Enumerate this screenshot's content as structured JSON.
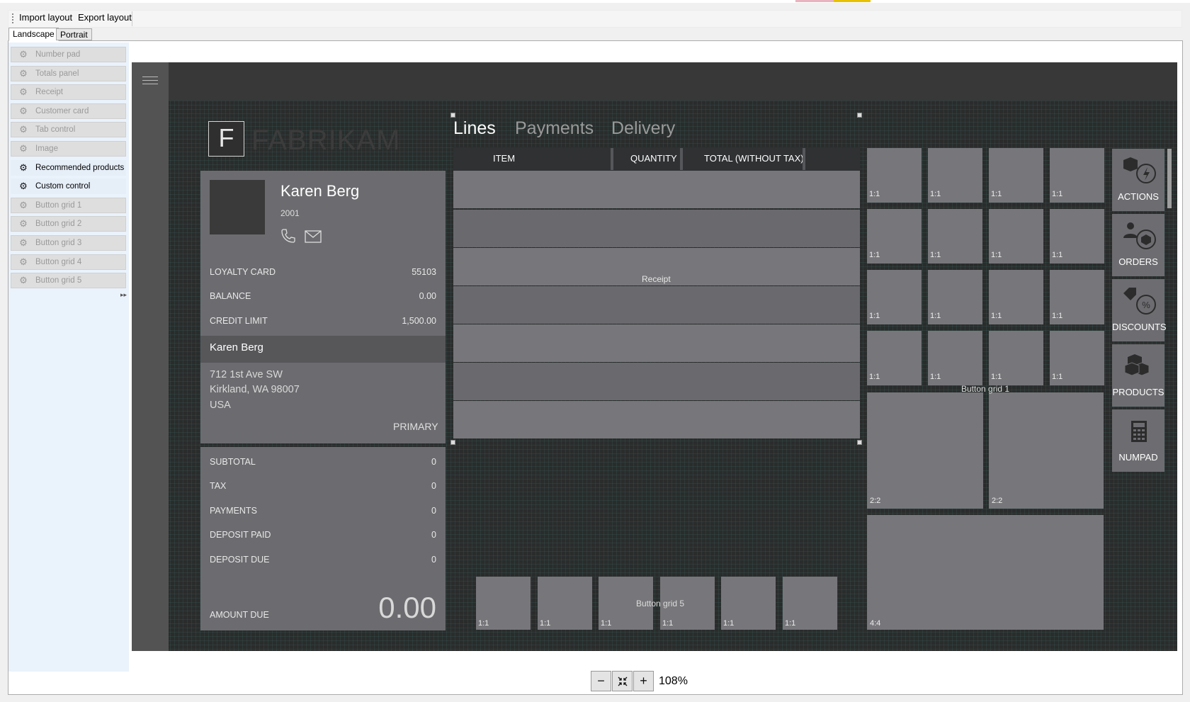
{
  "menu": {
    "import_label": "Import layout",
    "export_label": "Export layout"
  },
  "tabs": [
    "Landscape",
    "Portrait"
  ],
  "controls": [
    {
      "label": "Number pad",
      "enabled": false
    },
    {
      "label": "Totals panel",
      "enabled": false
    },
    {
      "label": "Receipt",
      "enabled": false
    },
    {
      "label": "Customer card",
      "enabled": false
    },
    {
      "label": "Tab control",
      "enabled": false
    },
    {
      "label": "Image",
      "enabled": false
    },
    {
      "label": "Recommended products",
      "enabled": true
    },
    {
      "label": "Custom control",
      "enabled": true
    },
    {
      "label": "Button grid 1",
      "enabled": false
    },
    {
      "label": "Button grid 2",
      "enabled": false
    },
    {
      "label": "Button grid 3",
      "enabled": false
    },
    {
      "label": "Button grid 4",
      "enabled": false
    },
    {
      "label": "Button grid 5",
      "enabled": false
    }
  ],
  "logo": {
    "letter": "F",
    "text": "FABRIKAM"
  },
  "customer": {
    "name": "Karen Berg",
    "number": "2001",
    "rows": [
      {
        "label": "LOYALTY CARD",
        "value": "55103"
      },
      {
        "label": "BALANCE",
        "value": "0.00"
      },
      {
        "label": "CREDIT LIMIT",
        "value": "1,500.00"
      }
    ],
    "address_name": "Karen Berg",
    "address_lines": [
      "712 1st Ave SW",
      "Kirkland, WA 98007",
      "USA"
    ],
    "address_type": "PRIMARY"
  },
  "totals": {
    "rows": [
      {
        "label": "SUBTOTAL",
        "value": "0"
      },
      {
        "label": "TAX",
        "value": "0"
      },
      {
        "label": "PAYMENTS",
        "value": "0"
      },
      {
        "label": "DEPOSIT PAID",
        "value": "0"
      },
      {
        "label": "DEPOSIT DUE",
        "value": "0"
      }
    ],
    "amount_due_label": "AMOUNT DUE",
    "amount_due_value": "0.00"
  },
  "receipt_tabs": [
    "Lines",
    "Payments",
    "Delivery"
  ],
  "receipt_columns": [
    "ITEM",
    "QUANTITY",
    "TOTAL (WITHOUT TAX)"
  ],
  "receipt_label": "Receipt",
  "button_grid_1": {
    "label": "Button grid 1",
    "small_size": "1:1",
    "medium_size": "2:2",
    "large_size": "4:4"
  },
  "actions": [
    "ACTIONS",
    "ORDERS",
    "DISCOUNTS",
    "PRODUCTS",
    "NUMPAD"
  ],
  "button_grid_5": {
    "label": "Button grid 5",
    "size": "1:1"
  },
  "zoom": {
    "minus": "−",
    "plus": "+",
    "level": "108%"
  }
}
